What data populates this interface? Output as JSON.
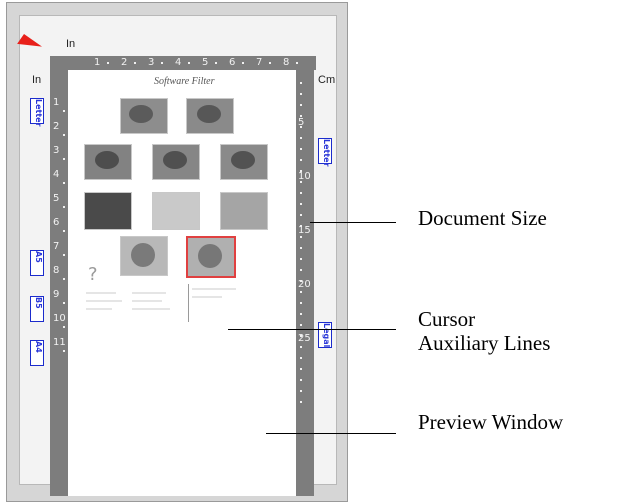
{
  "scanner_preview": {
    "top_unit": "In",
    "left_unit": "In",
    "right_unit": "Cm",
    "top_ruler_ticks": [
      "1",
      "2",
      "3",
      "4",
      "5",
      "6",
      "7",
      "8"
    ],
    "left_ruler_ticks": [
      "1",
      "2",
      "3",
      "4",
      "5",
      "6",
      "7",
      "8",
      "9",
      "10",
      "11"
    ],
    "right_ruler_ticks": [
      "5",
      "10",
      "15",
      "20",
      "25"
    ],
    "document_title": "Software Filter",
    "page_question_mark": "?",
    "left_markers": [
      "Letter",
      "A5",
      "B5",
      "A4"
    ],
    "right_markers": [
      "Letter",
      "Legal"
    ]
  },
  "callouts": {
    "document_size": "Document Size",
    "cursor_line1": "Cursor",
    "cursor_line2": "Auxiliary Lines",
    "preview_window": "Preview Window"
  }
}
